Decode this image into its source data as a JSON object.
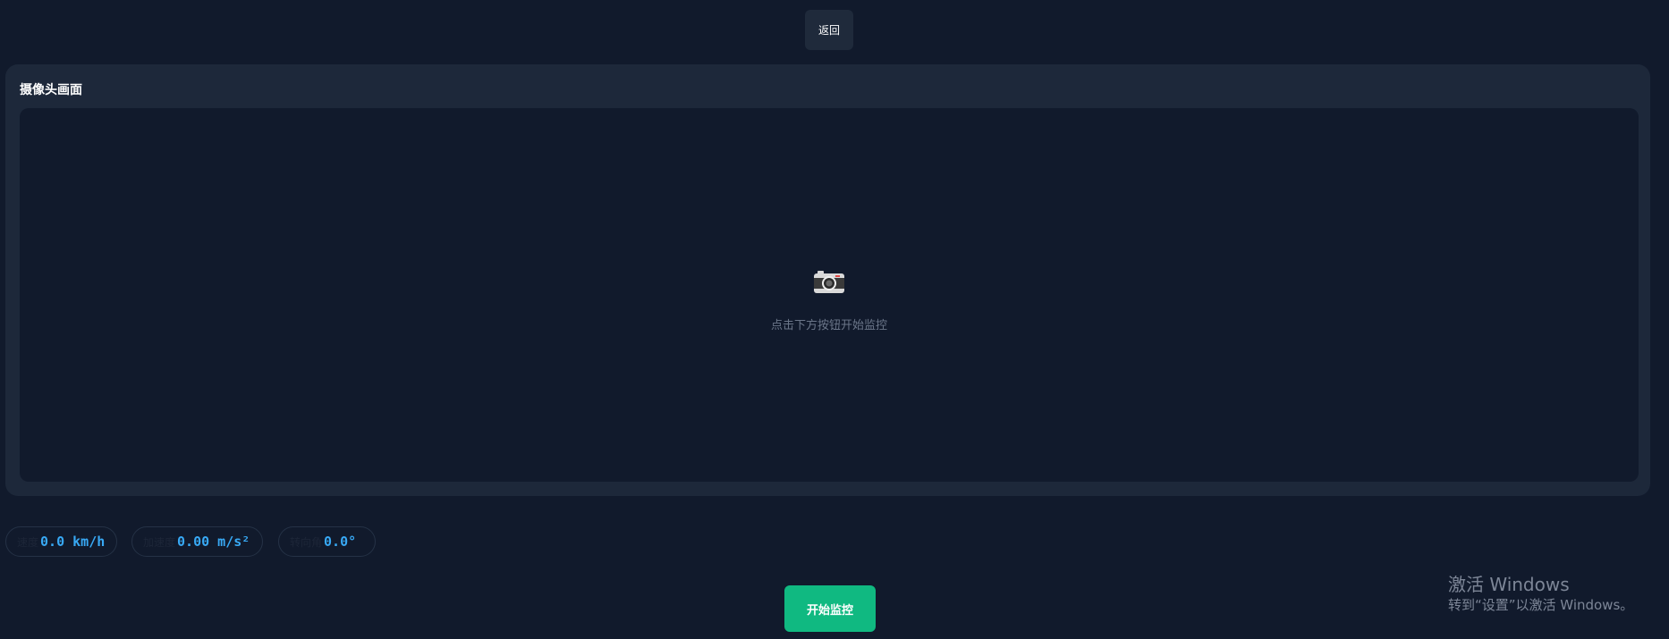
{
  "header": {
    "back_label": "返回"
  },
  "camera_panel": {
    "title": "摄像头画面",
    "icon": "camera-icon",
    "placeholder": "点击下方按钮开始监控"
  },
  "stats": {
    "speed": {
      "label": "速度",
      "value": "0.0 km/h"
    },
    "acceleration": {
      "label": "加速度",
      "value": "0.00 m/s²"
    },
    "steering": {
      "label": "转向角",
      "value": "0.0°"
    }
  },
  "actions": {
    "start_label": "开始监控"
  },
  "watermark": {
    "title": "激活 Windows",
    "subtitle": "转到“设置”以激活 Windows。"
  },
  "colors": {
    "background": "#111a2c",
    "panel": "#1d283a",
    "accent_green": "#10b981",
    "value_blue": "#38a9f5"
  }
}
